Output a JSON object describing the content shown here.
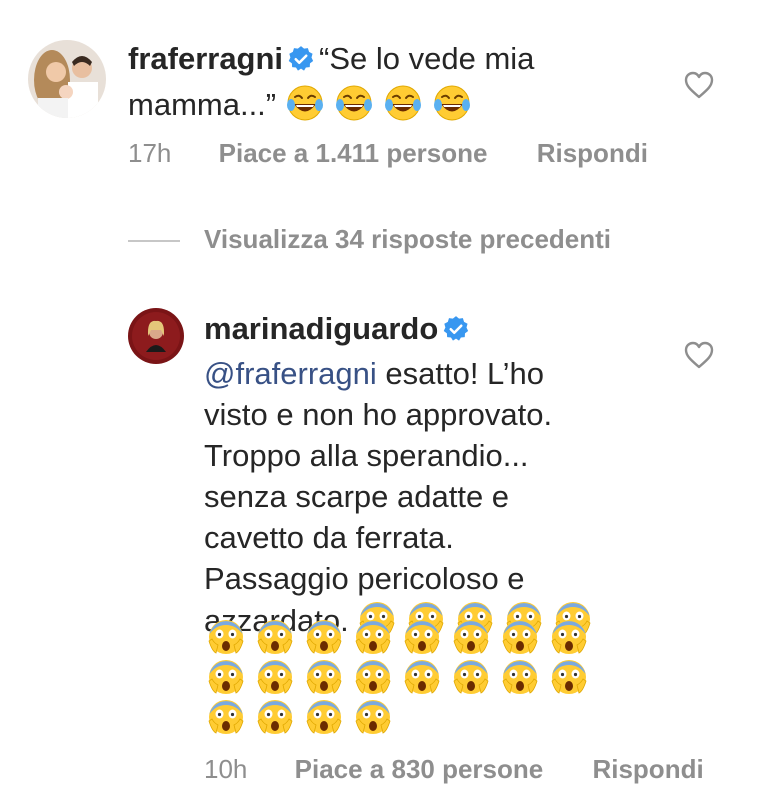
{
  "comment1": {
    "username": "fraferragni",
    "text_line1": "“Se lo vede mia",
    "text_line2": "mamma...”",
    "emoji_count": 4,
    "emoji_type": "tears-of-joy",
    "time": "17h",
    "likes": "Piace a 1.411 persone",
    "reply": "Rispondi"
  },
  "view_previous": "Visualizza 34 risposte precedenti",
  "comment2": {
    "username": "marinadiguardo",
    "mention": "@fraferragni",
    "line1_rest": " esatto! L’ho",
    "line2": "visto e non ho approvato.",
    "line3": "Troppo alla sperandio...",
    "line4": "senza scarpe adatte e",
    "line5": "cavetto da ferrata.",
    "line6": "Passaggio pericoloso e",
    "line7": "azzardato.",
    "emoji_type": "screaming-in-fear",
    "emoji_total": 25,
    "time": "10h",
    "likes": "Piace a 830 persone",
    "reply": "Rispondi"
  },
  "colors": {
    "text": "#262626",
    "meta": "#8e8e8e",
    "mention": "#385185",
    "verified": "#3897f0"
  }
}
